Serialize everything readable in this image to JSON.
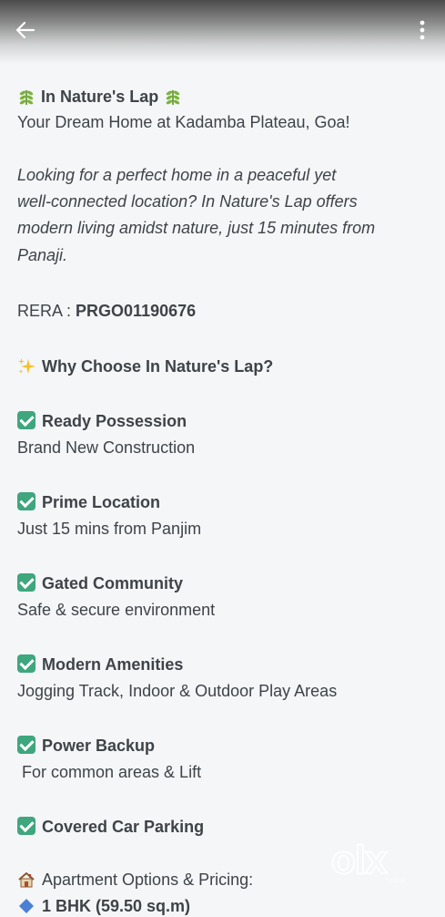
{
  "header": {
    "back_icon": "arrow-left-icon",
    "more_icon": "kebab-menu-icon"
  },
  "description": {
    "title": "In Nature's Lap",
    "subtitle": "Your Dream Home at Kadamba Plateau, Goa!",
    "intro_lines": [
      "Looking for a perfect home in a peaceful yet",
      "well-connected location? In Nature's Lap offers",
      "modern living amidst nature, just 15 minutes from",
      "Panaji."
    ],
    "rera_label": "RERA : ",
    "rera_value": "PRGO01190676",
    "why_heading": "Why Choose In Nature's Lap?",
    "features": [
      {
        "title": "Ready Possession",
        "detail": "Brand New Construction"
      },
      {
        "title": "Prime Location",
        "detail": "Just 15 mins from Panjim"
      },
      {
        "title": "Gated Community",
        "detail": "Safe & secure environment"
      },
      {
        "title": "Modern Amenities",
        "detail": "Jogging Track, Indoor & Outdoor Play Areas"
      },
      {
        "title": "Power Backup",
        "detail": " For common areas & Lift"
      },
      {
        "title": "Covered Car Parking",
        "detail": ""
      }
    ],
    "options_heading": "Apartment Options & Pricing:",
    "options": [
      "1 BHK (59.50 sq.m)"
    ]
  },
  "watermark": {
    "brand": "olx",
    "region": "INDIA"
  },
  "colors": {
    "text": "#3f4347",
    "background": "#f4f6f8",
    "check": "#3fa67e"
  }
}
